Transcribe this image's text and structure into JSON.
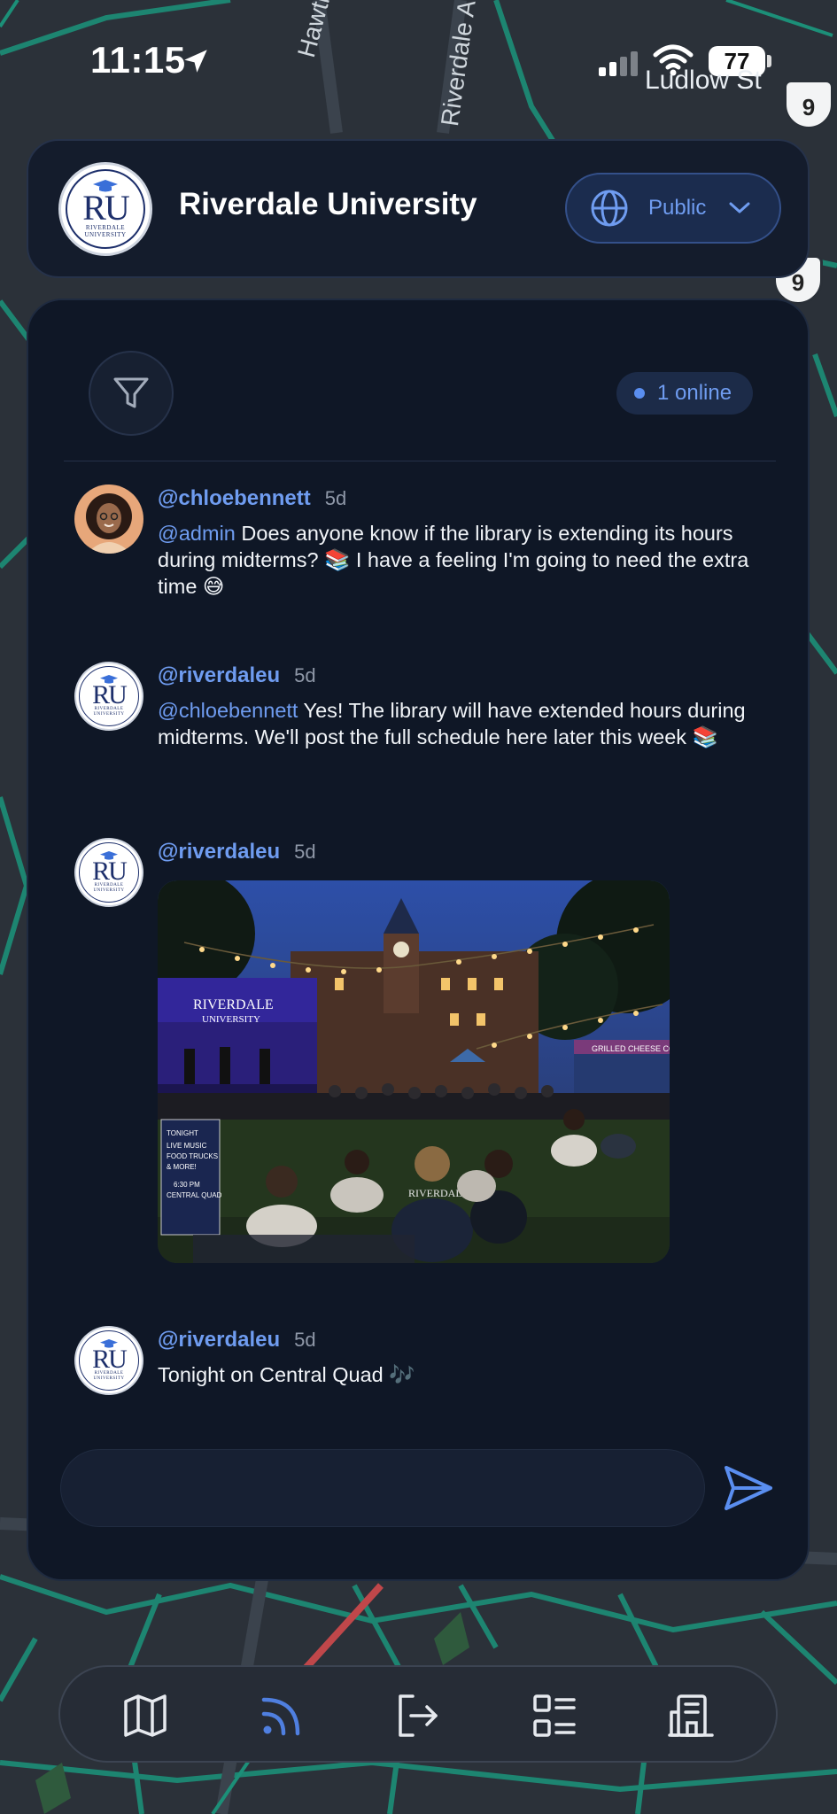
{
  "status_bar": {
    "time": "11:15",
    "battery": "77",
    "street": "Ludlow St"
  },
  "map_labels": {
    "road_1": "Hawthorne",
    "road_2": "Riverdale A",
    "shield_1": "9",
    "shield_2": "9"
  },
  "header": {
    "logo_text": "RU",
    "logo_subtext": "RIVERDALE UNIVERSITY",
    "title": "Riverdale University",
    "visibility_label": "Public"
  },
  "chat": {
    "online_label": "1 online",
    "messages": [
      {
        "handle": "@chloebennett",
        "time": "5d",
        "mention": "@admin",
        "text": " Does anyone know if the library is extending its hours during midterms? 📚 I have a feeling I'm going to need the extra time 😅"
      },
      {
        "handle": "@riverdaleu",
        "time": "5d",
        "mention": "@chloebennett",
        "text": " Yes! The library will have extended hours during midterms. We'll post the full schedule here later this week 📚"
      },
      {
        "handle": "@riverdaleu",
        "time": "5d",
        "photo": {
          "stage_banner": "RIVERDALE UNIVERSITY",
          "truck_sign": "GRILLED CHEESE CO.",
          "poster_lines": [
            "TONIGHT",
            "LIVE MUSIC",
            "FOOD TRUCKS",
            "& MORE!",
            "6:30 PM",
            "CENTRAL QUAD"
          ],
          "hoodie": "RIVERDALE"
        }
      },
      {
        "handle": "@riverdaleu",
        "time": "5d",
        "text": "Tonight on Central Quad 🎶"
      }
    ],
    "composer_placeholder": ""
  },
  "bottom_nav": {
    "items": [
      "map-icon",
      "feed-icon",
      "logout-icon",
      "list-icon",
      "building-icon"
    ],
    "active": "feed-icon"
  },
  "colors": {
    "accent": "#6f9cf0",
    "card": "#0f1726",
    "map_road": "#1fae8e"
  }
}
